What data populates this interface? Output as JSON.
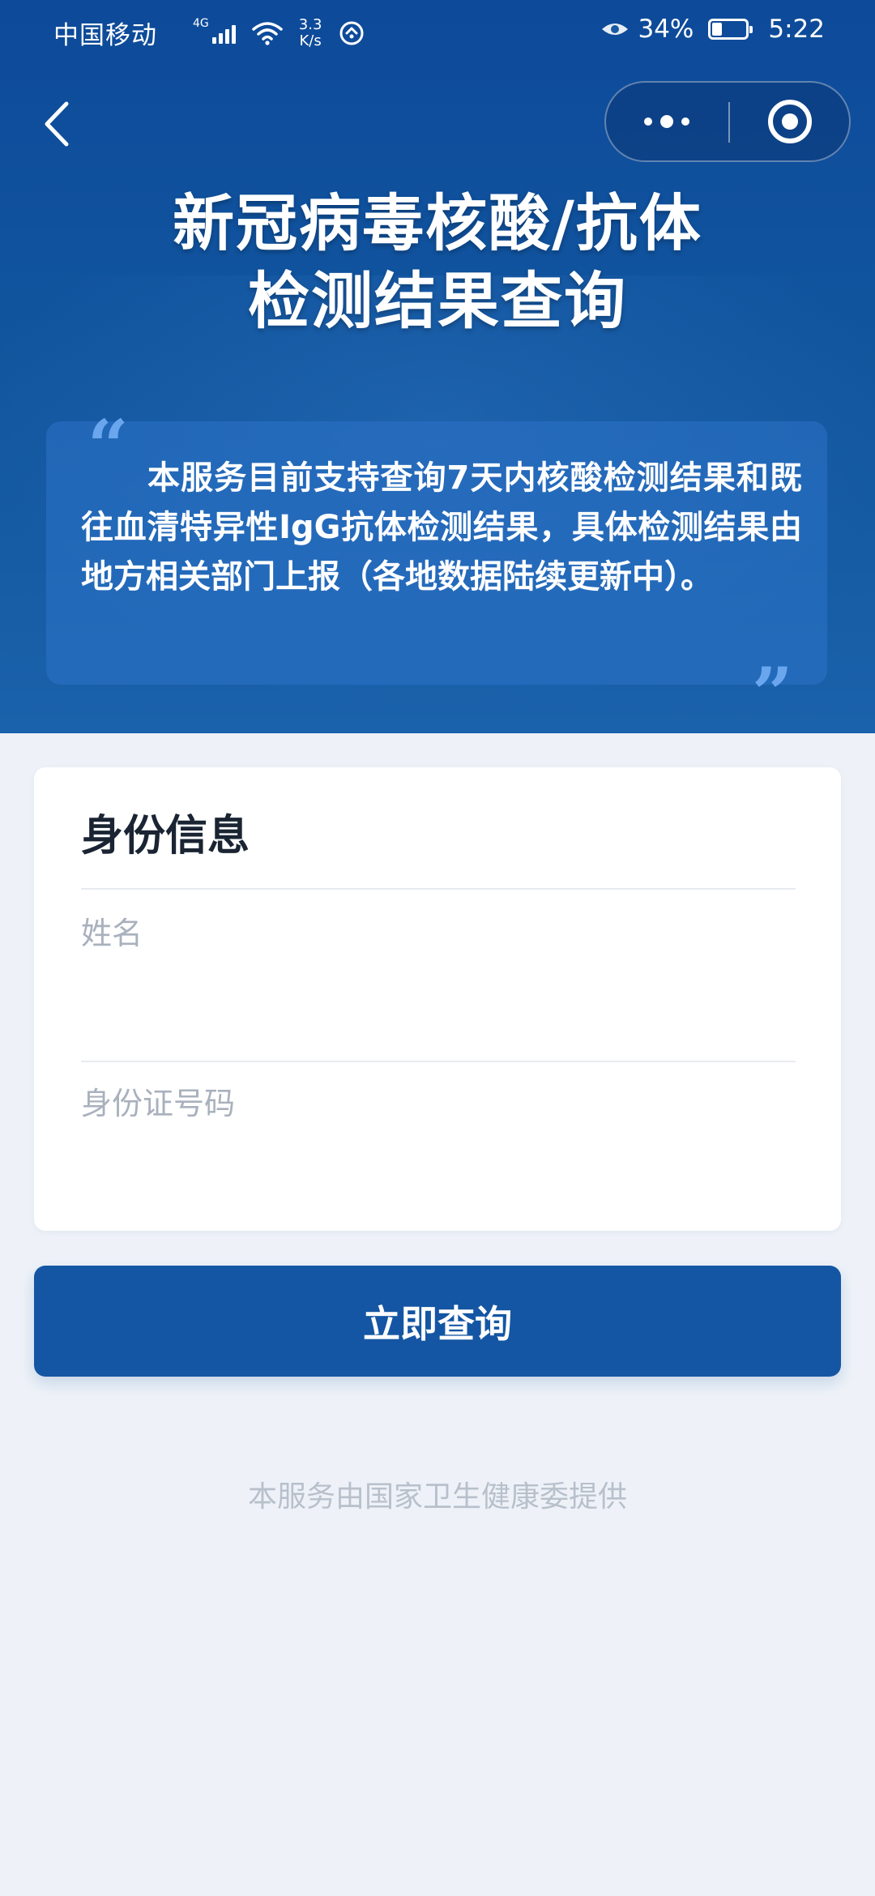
{
  "status_bar": {
    "carrier": "中国移动",
    "network_gen": "4G",
    "net_speed_value": "3.3",
    "net_speed_unit": "K/s",
    "battery": "34%",
    "time": "5:22"
  },
  "header": {
    "title_line1": "新冠病毒核酸/抗体",
    "title_line2": "检测结果查询"
  },
  "notice": {
    "quote_open": "“",
    "quote_close": "”",
    "text": "本服务目前支持查询7天内核酸检测结果和既往血清特异性IgG抗体检测结果，具体检测结果由地方相关部门上报（各地数据陆续更新中）。"
  },
  "form": {
    "title": "身份信息",
    "name": {
      "value": "",
      "placeholder": "姓名"
    },
    "id_number": {
      "value": "",
      "placeholder": "身份证号码"
    }
  },
  "actions": {
    "submit_label": "立即查询"
  },
  "footer": {
    "note": "本服务由国家卫生健康委提供"
  },
  "colors": {
    "header_blue": "#12579f",
    "button_blue": "#1456a3",
    "page_background": "#eef2f8",
    "quote_blue": "#6aa6ee"
  }
}
